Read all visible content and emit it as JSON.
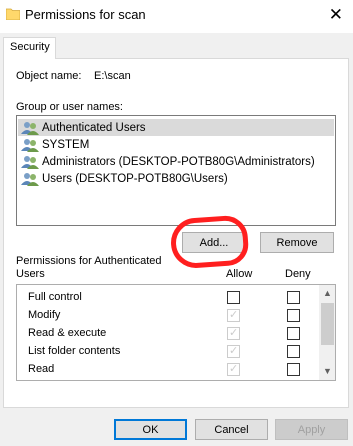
{
  "window": {
    "title": "Permissions for scan",
    "close_glyph": "✕",
    "folder_icon_color": "#ffd86b"
  },
  "tabs": [
    {
      "label": "Security",
      "selected": true
    }
  ],
  "object": {
    "label": "Object name:",
    "value": "E:\\scan"
  },
  "users": {
    "label": "Group or user names:",
    "items": [
      {
        "label": "Authenticated Users",
        "selected": true,
        "icon": "user-group-icon"
      },
      {
        "label": "SYSTEM",
        "selected": false,
        "icon": "user-group-icon"
      },
      {
        "label": "Administrators (DESKTOP-POTB80G\\Administrators)",
        "selected": false,
        "icon": "user-group-icon"
      },
      {
        "label": "Users (DESKTOP-POTB80G\\Users)",
        "selected": false,
        "icon": "user-group-icon"
      }
    ]
  },
  "buttons": {
    "add": "Add...",
    "remove": "Remove",
    "ok": "OK",
    "cancel": "Cancel",
    "apply": "Apply"
  },
  "permissions": {
    "label_line1": "Permissions for Authenticated",
    "label_line2": "Users",
    "allow_header": "Allow",
    "deny_header": "Deny",
    "rows": [
      {
        "name": "Full control",
        "allow": false,
        "allow_disabled": false,
        "deny": false
      },
      {
        "name": "Modify",
        "allow": true,
        "allow_disabled": true,
        "deny": false
      },
      {
        "name": "Read & execute",
        "allow": true,
        "allow_disabled": true,
        "deny": false
      },
      {
        "name": "List folder contents",
        "allow": true,
        "allow_disabled": true,
        "deny": false
      },
      {
        "name": "Read",
        "allow": true,
        "allow_disabled": true,
        "deny": false
      }
    ]
  },
  "annotation": {
    "color": "#ff1f1f",
    "target": "add-button"
  }
}
